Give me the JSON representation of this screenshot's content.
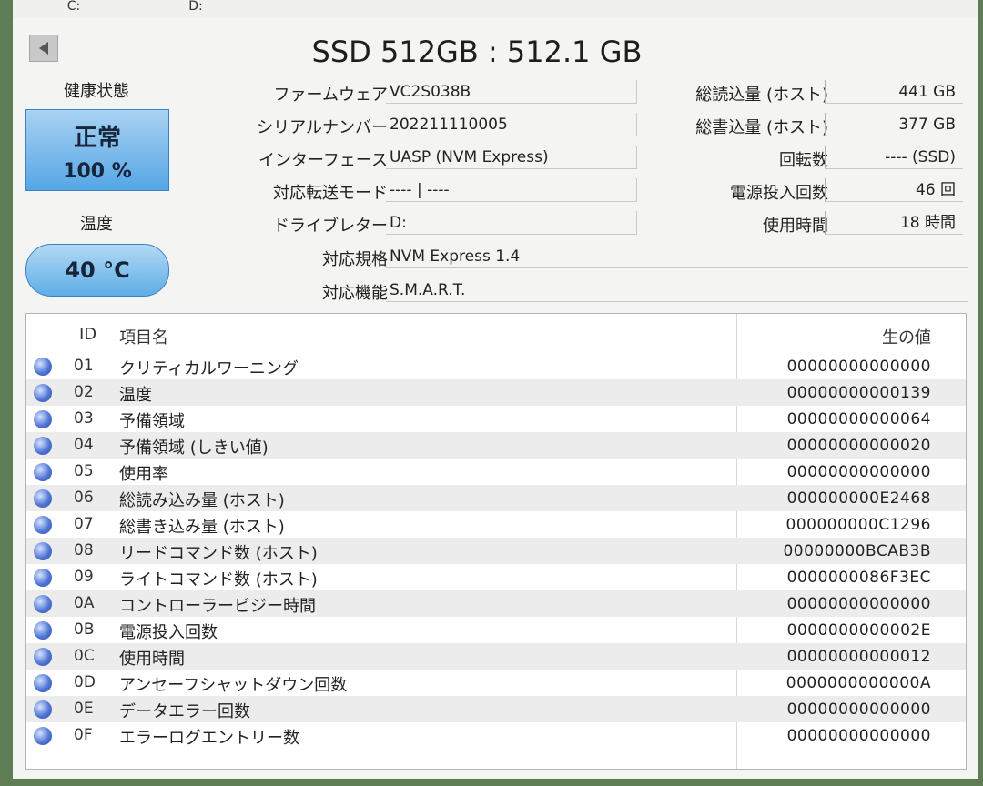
{
  "tabs": [
    {
      "label": "C:"
    },
    {
      "label": "D:"
    }
  ],
  "disk": {
    "title": "SSD 512GB : 512.1 GB"
  },
  "health": {
    "label": "健康状態",
    "status": "正常",
    "percent": "100 %"
  },
  "temperature": {
    "label": "温度",
    "value": "40 °C"
  },
  "info": {
    "firmware": {
      "label": "ファームウェア",
      "value": "VC2S038B"
    },
    "serial": {
      "label": "シリアルナンバー",
      "value": "202211110005"
    },
    "interface": {
      "label": "インターフェース",
      "value": "UASP (NVM Express)"
    },
    "transfer_mode": {
      "label": "対応転送モード",
      "value": "---- | ----"
    },
    "drive_letter": {
      "label": "ドライブレター",
      "value": "D:"
    },
    "standard": {
      "label": "対応規格",
      "value": "NVM Express 1.4"
    },
    "features": {
      "label": "対応機能",
      "value": "S.M.A.R.T."
    }
  },
  "stats": {
    "total_reads": {
      "label": "総読込量 (ホスト)",
      "value": "441 GB"
    },
    "total_writes": {
      "label": "総書込量 (ホスト)",
      "value": "377 GB"
    },
    "rotation": {
      "label": "回転数",
      "value": "---- (SSD)"
    },
    "power_on_count": {
      "label": "電源投入回数",
      "value": "46 回"
    },
    "power_on_hours": {
      "label": "使用時間",
      "value": "18 時間"
    }
  },
  "smart": {
    "headers": {
      "id": "ID",
      "name": "項目名",
      "raw": "生の値"
    },
    "status_color": "#4a6fd0",
    "rows": [
      {
        "id": "01",
        "name": "クリティカルワーニング",
        "raw": "00000000000000"
      },
      {
        "id": "02",
        "name": "温度",
        "raw": "00000000000139"
      },
      {
        "id": "03",
        "name": "予備領域",
        "raw": "00000000000064"
      },
      {
        "id": "04",
        "name": "予備領域 (しきい値)",
        "raw": "00000000000020"
      },
      {
        "id": "05",
        "name": "使用率",
        "raw": "00000000000000"
      },
      {
        "id": "06",
        "name": "総読み込み量 (ホスト)",
        "raw": "000000000E2468"
      },
      {
        "id": "07",
        "name": "総書き込み量 (ホスト)",
        "raw": "000000000C1296"
      },
      {
        "id": "08",
        "name": "リードコマンド数 (ホスト)",
        "raw": "00000000BCAB3B"
      },
      {
        "id": "09",
        "name": "ライトコマンド数 (ホスト)",
        "raw": "0000000086F3EC"
      },
      {
        "id": "0A",
        "name": "コントローラービジー時間",
        "raw": "00000000000000"
      },
      {
        "id": "0B",
        "name": "電源投入回数",
        "raw": "0000000000002E"
      },
      {
        "id": "0C",
        "name": "使用時間",
        "raw": "00000000000012"
      },
      {
        "id": "0D",
        "name": "アンセーフシャットダウン回数",
        "raw": "0000000000000A"
      },
      {
        "id": "0E",
        "name": "データエラー回数",
        "raw": "00000000000000"
      },
      {
        "id": "0F",
        "name": "エラーログエントリー数",
        "raw": "00000000000000"
      }
    ]
  }
}
